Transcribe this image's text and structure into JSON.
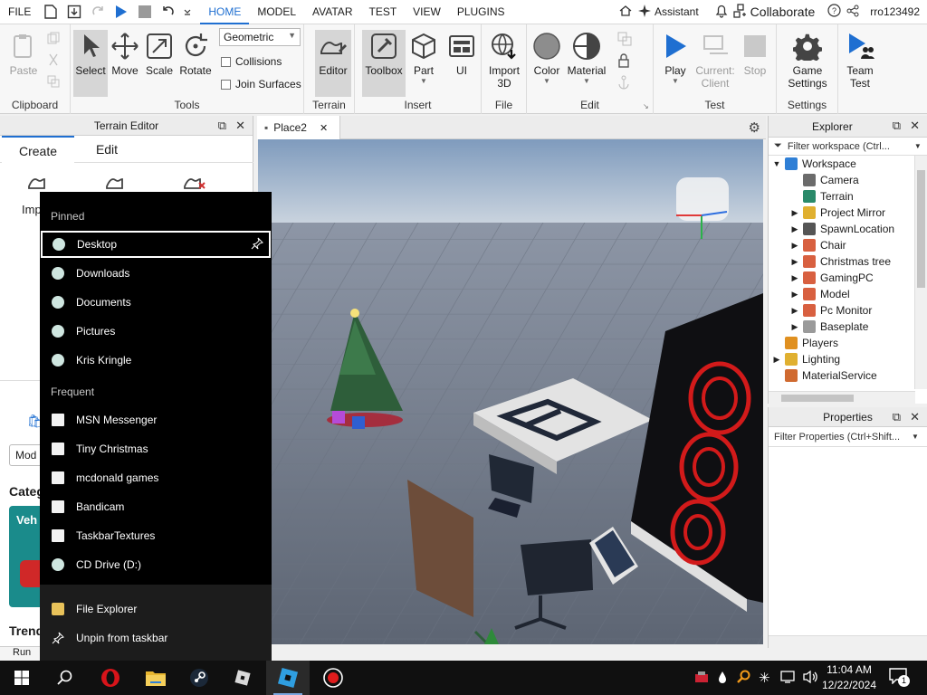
{
  "menubar": {
    "file_label": "FILE",
    "tabs": [
      "HOME",
      "MODEL",
      "AVATAR",
      "TEST",
      "VIEW",
      "PLUGINS"
    ],
    "active_tab": "HOME",
    "assistant_label": "Assistant",
    "collaborate_label": "Collaborate",
    "username": "rro123492"
  },
  "ribbon": {
    "clipboard": {
      "paste": "Paste",
      "group": "Clipboard"
    },
    "tools": {
      "select": "Select",
      "move": "Move",
      "scale": "Scale",
      "rotate": "Rotate",
      "mode_value": "Geometric",
      "collisions": "Collisions",
      "join_surfaces": "Join Surfaces",
      "group": "Tools"
    },
    "terrain": {
      "editor": "Editor",
      "group": "Terrain"
    },
    "insert": {
      "toolbox": "Toolbox",
      "part": "Part",
      "ui": "UI",
      "group": "Insert"
    },
    "file": {
      "import": "Import",
      "import2": "3D",
      "group": "File"
    },
    "edit": {
      "color": "Color",
      "material": "Material",
      "group": "Edit"
    },
    "test": {
      "play": "Play",
      "current": "Current:",
      "client": "Client",
      "stop": "Stop",
      "group": "Test"
    },
    "settings": {
      "game": "Game",
      "game2": "Settings",
      "group": "Settings"
    },
    "team": {
      "team": "Team",
      "test": "Test"
    }
  },
  "terrain_editor": {
    "title": "Terrain Editor",
    "tabs": [
      "Create",
      "Edit"
    ],
    "partial_import": "Imp",
    "partial_mod": "Mod",
    "partial_categ": "Categ",
    "partial_veh": "Veh",
    "partial_trend": "Trend",
    "partial_run": "Run"
  },
  "viewport": {
    "tab_label": "Place2"
  },
  "explorer": {
    "title": "Explorer",
    "filter_placeholder": "Filter workspace (Ctrl...",
    "items": [
      {
        "label": "Workspace",
        "level": 0,
        "expanded": true,
        "icon_color": "#2f7fd6"
      },
      {
        "label": "Camera",
        "level": 1,
        "expanded": null,
        "icon_color": "#6b6b6b"
      },
      {
        "label": "Terrain",
        "level": 1,
        "expanded": null,
        "icon_color": "#2a8a6a"
      },
      {
        "label": "Project Mirror",
        "level": 1,
        "expanded": false,
        "icon_color": "#e0b030"
      },
      {
        "label": "SpawnLocation",
        "level": 1,
        "expanded": false,
        "icon_color": "#555555"
      },
      {
        "label": "Chair",
        "level": 1,
        "expanded": false,
        "icon_color": "#d86040"
      },
      {
        "label": "Christmas tree",
        "level": 1,
        "expanded": false,
        "icon_color": "#d86040"
      },
      {
        "label": "GamingPC",
        "level": 1,
        "expanded": false,
        "icon_color": "#d86040"
      },
      {
        "label": "Model",
        "level": 1,
        "expanded": false,
        "icon_color": "#d86040"
      },
      {
        "label": "Pc Monitor",
        "level": 1,
        "expanded": false,
        "icon_color": "#d86040"
      },
      {
        "label": "Baseplate",
        "level": 1,
        "expanded": false,
        "icon_color": "#9a9a9a"
      },
      {
        "label": "Players",
        "level": 0,
        "expanded": null,
        "icon_color": "#e09020"
      },
      {
        "label": "Lighting",
        "level": 0,
        "expanded": false,
        "icon_color": "#e0b030"
      },
      {
        "label": "MaterialService",
        "level": 0,
        "expanded": null,
        "icon_color": "#d06a30"
      }
    ]
  },
  "properties": {
    "title": "Properties",
    "filter_placeholder": "Filter Properties (Ctrl+Shift..."
  },
  "jumplist": {
    "pinned_header": "Pinned",
    "pinned": [
      "Desktop",
      "Downloads",
      "Documents",
      "Pictures",
      "Kris Kringle"
    ],
    "frequent_header": "Frequent",
    "frequent": [
      "MSN Messenger",
      "Tiny Christmas",
      "mcdonald games",
      "Bandicam",
      "TaskbarTextures",
      "CD Drive (D:)"
    ],
    "actions": [
      "File Explorer",
      "Unpin from taskbar"
    ]
  },
  "taskbar": {
    "time": "11:04 AM",
    "date": "12/22/2024",
    "notification_count": "1"
  }
}
